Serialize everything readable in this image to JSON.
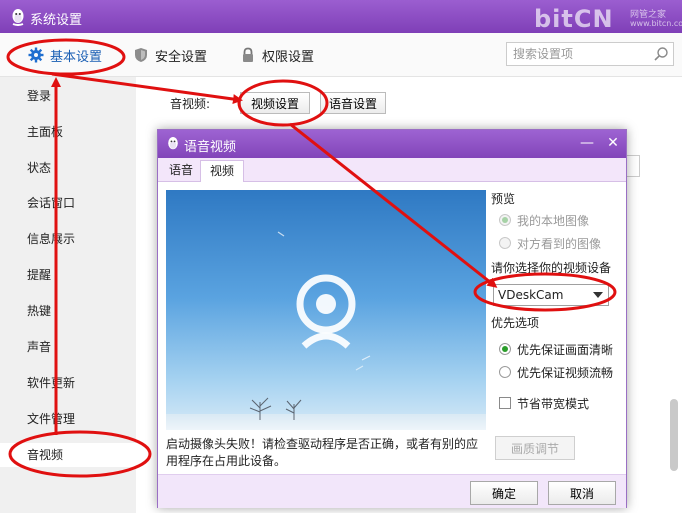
{
  "main_window": {
    "title": "系统设置",
    "watermark": {
      "brand": "bitCN",
      "sub": "网管之家",
      "url": "www.bitcn.com"
    }
  },
  "top_tabs": [
    {
      "label": "基本设置",
      "icon": "gear-icon",
      "active": true
    },
    {
      "label": "安全设置",
      "icon": "shield-icon"
    },
    {
      "label": "权限设置",
      "icon": "lock-icon"
    }
  ],
  "search": {
    "placeholder": "搜索设置项"
  },
  "sidebar": {
    "items": [
      {
        "label": "登录"
      },
      {
        "label": "主面板"
      },
      {
        "label": "状态"
      },
      {
        "label": "会话窗口"
      },
      {
        "label": "信息展示"
      },
      {
        "label": "提醒"
      },
      {
        "label": "热键"
      },
      {
        "label": "声音"
      },
      {
        "label": "软件更新"
      },
      {
        "label": "文件管理"
      },
      {
        "label": "音视频",
        "active": true
      }
    ]
  },
  "content": {
    "av_label": "音视频:",
    "video_settings_button": "视频设置",
    "voice_settings_button": "语音设置"
  },
  "dialog": {
    "title": "语音视频",
    "minimize_glyph": "—",
    "close_glyph": "✕",
    "tabs": [
      {
        "label": "语音"
      },
      {
        "label": "视频",
        "active": true
      }
    ],
    "preview_heading": "预览",
    "preview_options": [
      {
        "label": "我的本地图像",
        "checked": true,
        "disabled": true
      },
      {
        "label": "对方看到的图像",
        "checked": false,
        "disabled": true
      }
    ],
    "device_heading": "请你选择你的视频设备",
    "device_selected": "VDeskCam",
    "priority_heading": "优先选项",
    "priority_options": [
      {
        "label": "优先保证画面清晰",
        "checked": true
      },
      {
        "label": "优先保证视频流畅",
        "checked": false
      }
    ],
    "bandwidth_label": "节省带宽模式",
    "quality_button": "画质调节",
    "camera_error": "启动摄像头失败！请检查驱动程序是否正确，或者有别的应用程序在占用此设备。",
    "ok_button": "确定",
    "cancel_button": "取消"
  },
  "colors": {
    "titlebar": "#8a4cc2",
    "annotation": "#e01010",
    "accent_green": "#2a9d2a",
    "link_blue": "#1a5fb4"
  }
}
